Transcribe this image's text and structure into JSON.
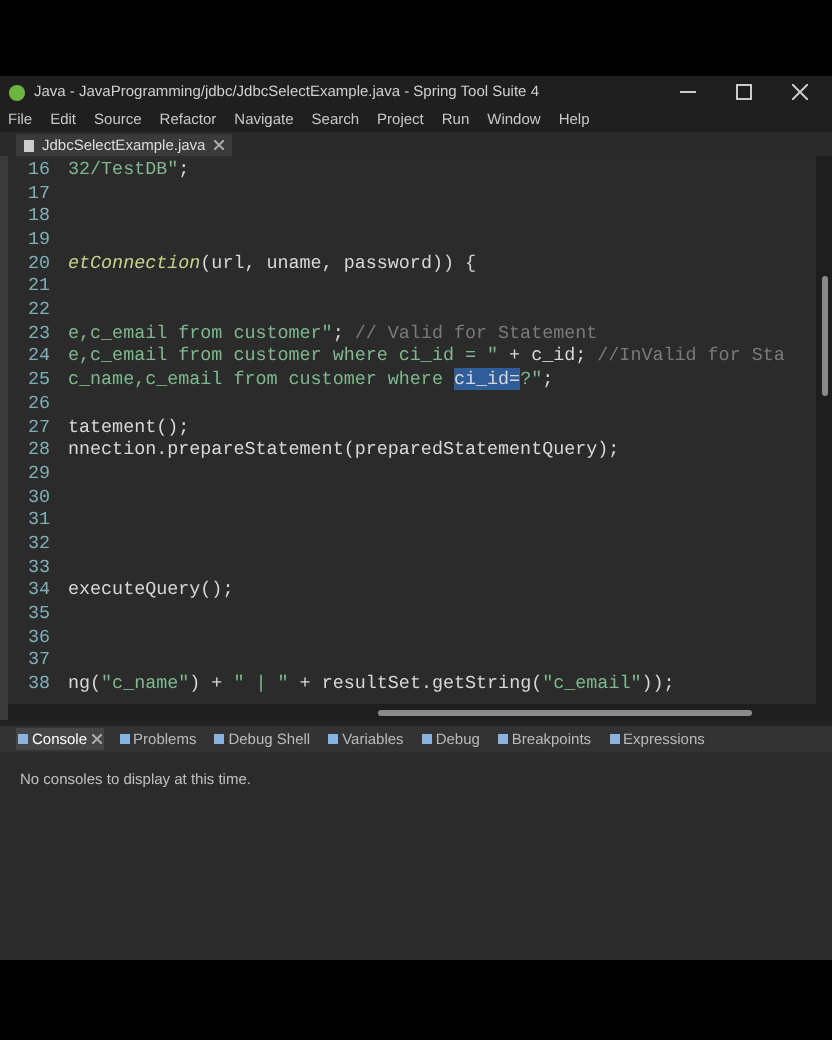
{
  "window": {
    "title": "Java - JavaProgramming/jdbc/JdbcSelectExample.java - Spring Tool Suite 4"
  },
  "menu": [
    "File",
    "Edit",
    "Source",
    "Refactor",
    "Navigate",
    "Search",
    "Project",
    "Run",
    "Window",
    "Help"
  ],
  "editor_tabs": [
    {
      "label": "JdbcSelectExample.java",
      "selected": true
    }
  ],
  "code_lines": [
    {
      "number": "16",
      "segments": [
        {
          "kind": "string",
          "text": "32/TestDB\""
        },
        {
          "kind": "plain",
          "text": ";"
        }
      ]
    },
    {
      "number": "17"
    },
    {
      "number": "18"
    },
    {
      "number": "19"
    },
    {
      "number": "20",
      "segments": [
        {
          "kind": "method",
          "text": "etConnection"
        },
        {
          "kind": "plain",
          "text": "(url, uname, password)) {"
        }
      ]
    },
    {
      "number": "21"
    },
    {
      "number": "22"
    },
    {
      "number": "23",
      "segments": [
        {
          "kind": "string",
          "text": "e,c_email from customer\""
        },
        {
          "kind": "plain",
          "text": "; "
        },
        {
          "kind": "comment",
          "text": "// Valid for Statement"
        }
      ]
    },
    {
      "number": "24",
      "segments": [
        {
          "kind": "string",
          "text": "e,c_email from customer where ci_id = \""
        },
        {
          "kind": "plain",
          "text": " + c_id; "
        },
        {
          "kind": "comment",
          "text": "//InValid for Sta"
        }
      ]
    },
    {
      "number": "25",
      "segments": [
        {
          "kind": "string",
          "text": "c_name,c_email from customer where "
        },
        {
          "kind": "selected",
          "text": "ci_id="
        },
        {
          "kind": "string",
          "text": "?\""
        },
        {
          "kind": "plain",
          "text": ";"
        }
      ]
    },
    {
      "number": "26"
    },
    {
      "number": "27",
      "segments": [
        {
          "kind": "plain",
          "text": "tatement();"
        }
      ]
    },
    {
      "number": "28",
      "segments": [
        {
          "kind": "plain",
          "text": "nnection.prepareStatement(preparedStatementQuery);"
        }
      ]
    },
    {
      "number": "29"
    },
    {
      "number": "30"
    },
    {
      "number": "31"
    },
    {
      "number": "32"
    },
    {
      "number": "33"
    },
    {
      "number": "34",
      "segments": [
        {
          "kind": "plain",
          "text": "executeQuery();"
        }
      ]
    },
    {
      "number": "35"
    },
    {
      "number": "36"
    },
    {
      "number": "37"
    },
    {
      "number": "38",
      "segments": [
        {
          "kind": "plain",
          "text": "ng("
        },
        {
          "kind": "string",
          "text": "\"c_name\""
        },
        {
          "kind": "plain",
          "text": ") + "
        },
        {
          "kind": "string",
          "text": "\" | \""
        },
        {
          "kind": "plain",
          "text": " + resultSet.getString("
        },
        {
          "kind": "string",
          "text": "\"c_email\""
        },
        {
          "kind": "plain",
          "text": "));"
        }
      ]
    }
  ],
  "console_tabs": [
    {
      "label": "Console",
      "selected": true
    },
    {
      "label": "Problems",
      "selected": false
    },
    {
      "label": "Debug Shell",
      "selected": false
    },
    {
      "label": "Variables",
      "selected": false
    },
    {
      "label": "Debug",
      "selected": false
    },
    {
      "label": "Breakpoints",
      "selected": false
    },
    {
      "label": "Expressions",
      "selected": false
    }
  ],
  "console": {
    "message": "No consoles to display at this time."
  }
}
